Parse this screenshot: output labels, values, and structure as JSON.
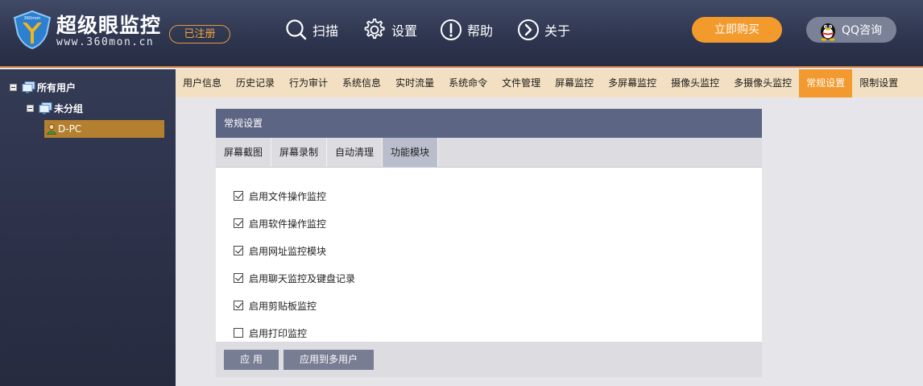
{
  "header": {
    "brand_title": "超级眼监控",
    "brand_url": "www.360mon.cn",
    "registered_label": "已注册",
    "nav": [
      {
        "label": "扫描",
        "icon": "search-icon"
      },
      {
        "label": "设置",
        "icon": "gear-icon"
      },
      {
        "label": "帮助",
        "icon": "exclamation-icon"
      },
      {
        "label": "关于",
        "icon": "chevron-right-icon"
      }
    ],
    "buy_label": "立即购买",
    "qq_label": "QQ咨询"
  },
  "sidebar": {
    "root_label": "所有用户",
    "group_label": "未分组",
    "pc_label": "D-PC"
  },
  "tabs": [
    {
      "label": "用户信息",
      "active": false
    },
    {
      "label": "历史记录",
      "active": false
    },
    {
      "label": "行为审计",
      "active": false
    },
    {
      "label": "系统信息",
      "active": false
    },
    {
      "label": "实时流量",
      "active": false
    },
    {
      "label": "系统命令",
      "active": false
    },
    {
      "label": "文件管理",
      "active": false
    },
    {
      "label": "屏幕监控",
      "active": false
    },
    {
      "label": "多屏幕监控",
      "active": false
    },
    {
      "label": "摄像头监控",
      "active": false
    },
    {
      "label": "多摄像头监控",
      "active": false
    },
    {
      "label": "常规设置",
      "active": true
    },
    {
      "label": "限制设置",
      "active": false
    }
  ],
  "panel": {
    "title": "常规设置",
    "subtabs": [
      {
        "label": "屏幕截图",
        "active": false
      },
      {
        "label": "屏幕录制",
        "active": false
      },
      {
        "label": "自动清理",
        "active": false
      },
      {
        "label": "功能模块",
        "active": true
      }
    ],
    "options": [
      {
        "label": "启用文件操作监控",
        "checked": true
      },
      {
        "label": "启用软件操作监控",
        "checked": true
      },
      {
        "label": "启用网址监控模块",
        "checked": true
      },
      {
        "label": "启用聊天监控及键盘记录",
        "checked": true
      },
      {
        "label": "启用剪贴板监控",
        "checked": true
      },
      {
        "label": "启用打印监控",
        "checked": false
      }
    ],
    "apply_label": "应 用",
    "apply_multi_label": "应用到多用户"
  },
  "colors": {
    "accent_orange": "#f29a2f",
    "header_dark": "#2f3650",
    "panel_title": "#5d6584"
  }
}
